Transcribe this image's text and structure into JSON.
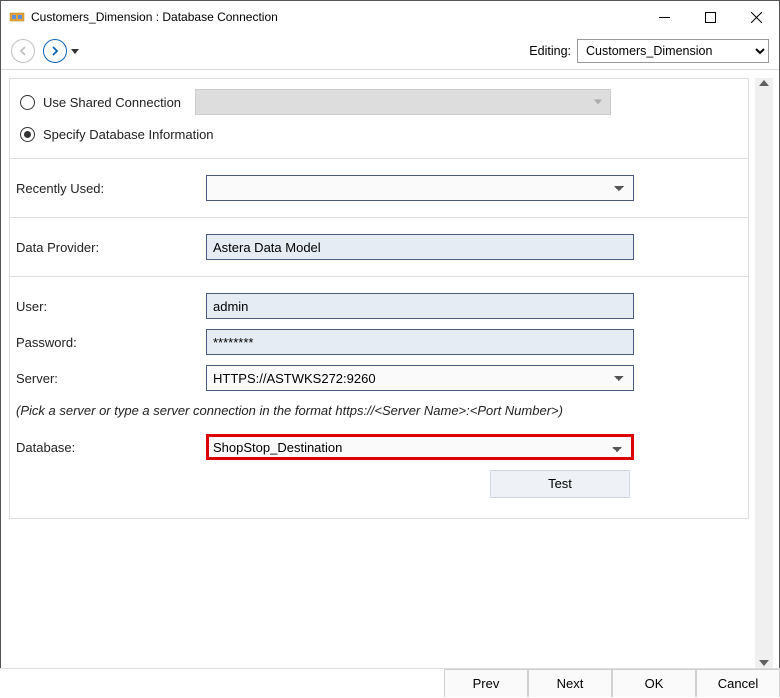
{
  "window": {
    "title": "Customers_Dimension : Database Connection"
  },
  "toolbar": {
    "editing_label": "Editing:",
    "editing_value": "Customers_Dimension"
  },
  "radios": {
    "use_shared": "Use Shared Connection",
    "specify_db": "Specify Database Information"
  },
  "fields": {
    "recently_used_label": "Recently Used:",
    "recently_used_value": "",
    "data_provider_label": "Data Provider:",
    "data_provider_value": "Astera Data Model",
    "user_label": "User:",
    "user_value": "admin",
    "password_label": "Password:",
    "password_value": "********",
    "server_label": "Server:",
    "server_value": "HTTPS://ASTWKS272:9260",
    "server_hint": "(Pick a server or type a server connection in the format  https://<Server Name>:<Port Number>)",
    "database_label": "Database:",
    "database_value": "ShopStop_Destination"
  },
  "buttons": {
    "test": "Test",
    "prev": "Prev",
    "next": "Next",
    "ok": "OK",
    "cancel": "Cancel"
  }
}
